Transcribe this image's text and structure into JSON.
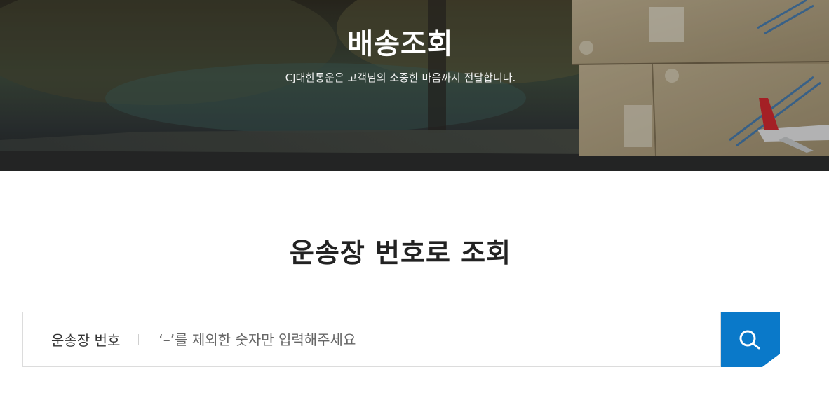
{
  "hero": {
    "title": "배송조회",
    "subtitle": "CJ대한통운은 고객님의 소중한 마음까지 전달합니다."
  },
  "tracking": {
    "section_title": "운송장 번호로 조회",
    "label": "운송장 번호",
    "placeholder": "‘–’를 제외한 숫자만 입력해주세요",
    "value": ""
  },
  "icons": {
    "search": "search-icon"
  },
  "colors": {
    "accent": "#0a79c9",
    "title_text": "#222222",
    "hero_text": "#ffffff"
  }
}
